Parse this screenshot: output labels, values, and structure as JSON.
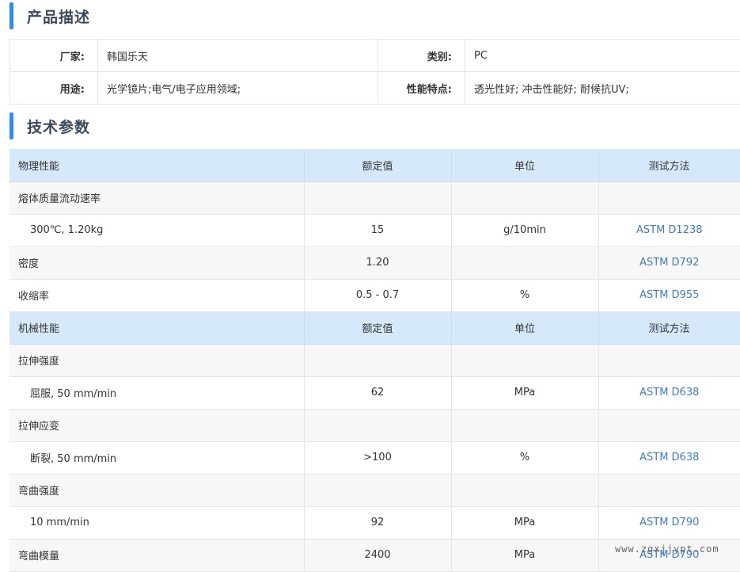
{
  "product_section": {
    "title": "产品描述",
    "rows": [
      {
        "label1": "厂家:",
        "value1": "韩国乐天",
        "label2": "类别:",
        "value2": "PC"
      },
      {
        "label1": "用途:",
        "value1": "光学镜片;电气/电子应用领域;",
        "label2": "性能特点:",
        "value2": "透光性好; 冲击性能好; 耐候抗UV;"
      }
    ]
  },
  "spec_section": {
    "title": "技术参数",
    "rows": [
      {
        "type": "header",
        "c1": "物理性能",
        "c2": "额定值",
        "c3": "单位",
        "c4": "测试方法"
      },
      {
        "type": "item",
        "c1": "熔体质量流动速率",
        "c2": "",
        "c3": "",
        "c4": ""
      },
      {
        "type": "sub",
        "c1": "300℃, 1.20kg",
        "c2": "15",
        "c3": "g/10min",
        "c4": "ASTM D1238"
      },
      {
        "type": "item",
        "c1": "密度",
        "c2": "1.20",
        "c3": "",
        "c4": "ASTM D792"
      },
      {
        "type": "item",
        "c1": "收缩率",
        "c2": "0.5 - 0.7",
        "c3": "%",
        "c4": "ASTM D955"
      },
      {
        "type": "header",
        "c1": "机械性能",
        "c2": "额定值",
        "c3": "单位",
        "c4": "测试方法"
      },
      {
        "type": "item",
        "c1": "拉伸强度",
        "c2": "",
        "c3": "",
        "c4": ""
      },
      {
        "type": "sub",
        "c1": "屈服, 50 mm/min",
        "c2": "62",
        "c3": "MPa",
        "c4": "ASTM D638"
      },
      {
        "type": "item",
        "c1": "拉伸应变",
        "c2": "",
        "c3": "",
        "c4": ""
      },
      {
        "type": "sub",
        "c1": "断裂, 50 mm/min",
        "c2": ">100",
        "c3": "%",
        "c4": "ASTM D638"
      },
      {
        "type": "item",
        "c1": "弯曲强度",
        "c2": "",
        "c3": "",
        "c4": ""
      },
      {
        "type": "sub",
        "c1": "10 mm/min",
        "c2": "92",
        "c3": "MPa",
        "c4": "ASTM D790"
      },
      {
        "type": "item",
        "c1": "弯曲模量",
        "c2": "2400",
        "c3": "MPa",
        "c4": "ASTM D790"
      }
    ]
  },
  "watermark": "www.zgxjjypt.com",
  "colors": {
    "accent": "#2d8cf0",
    "header_bg": "#d6e9fb",
    "link": "#3d7cc9"
  }
}
